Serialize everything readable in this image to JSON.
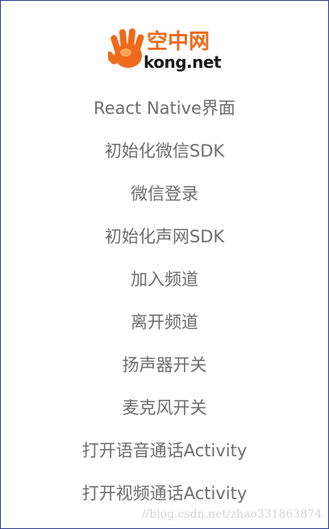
{
  "logo": {
    "icon": "orange-hand-icon",
    "text_cn": "空中网",
    "text_en": "kong.net"
  },
  "menu": {
    "items": [
      {
        "label": "React Native界面"
      },
      {
        "label": "初始化微信SDK"
      },
      {
        "label": "微信登录"
      },
      {
        "label": "初始化声网SDK"
      },
      {
        "label": "加入频道"
      },
      {
        "label": "离开频道"
      },
      {
        "label": "扬声器开关"
      },
      {
        "label": "麦克风开关"
      },
      {
        "label": "打开语音通话Activity"
      },
      {
        "label": "打开视频通话Activity"
      }
    ]
  },
  "watermark": {
    "text": "//blog.csdn.net/zhao331863874"
  },
  "colors": {
    "brand_orange": "#ee6a1c",
    "menu_text": "#6e6e6e",
    "frame_border": "#2c3d8c"
  }
}
